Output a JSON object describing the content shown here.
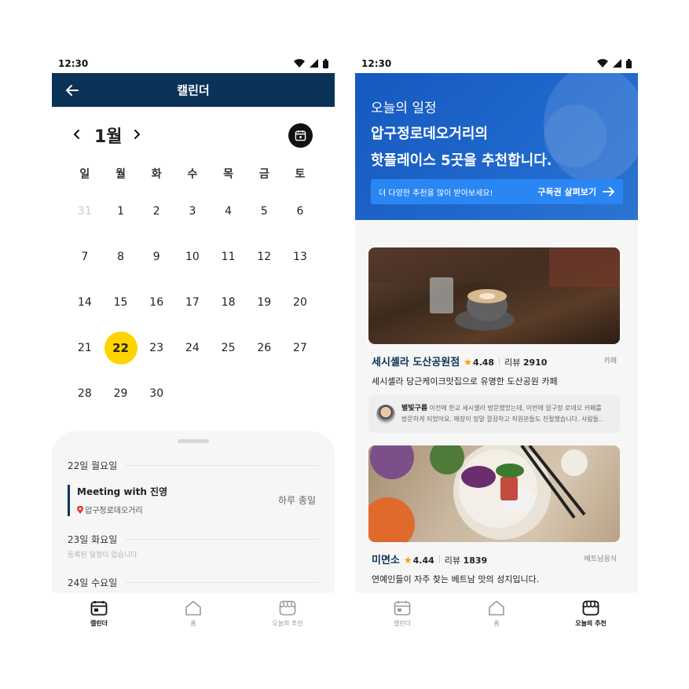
{
  "left": {
    "status": {
      "time": "12:30"
    },
    "appbar": {
      "title": "캘린더"
    },
    "calendar": {
      "month": "1월",
      "weekdays": [
        "일",
        "월",
        "화",
        "수",
        "목",
        "금",
        "토"
      ],
      "days": [
        "31",
        "1",
        "2",
        "3",
        "4",
        "5",
        "6",
        "7",
        "8",
        "9",
        "10",
        "11",
        "12",
        "13",
        "14",
        "15",
        "16",
        "17",
        "18",
        "19",
        "20",
        "21",
        "22",
        "23",
        "24",
        "25",
        "26",
        "27",
        "28",
        "29",
        "30"
      ],
      "selected": "22"
    },
    "schedule": {
      "day1": {
        "label": "22일 월요일"
      },
      "event": {
        "title": "Meeting with 진영",
        "location": "압구정로데오거리",
        "time": "하루 종일"
      },
      "day2": {
        "label": "23일 화요일",
        "empty": "등록된 일정이 없습니다"
      },
      "day3": {
        "label": "24일 수요일"
      }
    },
    "nav": {
      "calendar": "캘린더",
      "home": "홈",
      "today": "오늘의 추천"
    }
  },
  "right": {
    "status": {
      "time": "12:30"
    },
    "banner": {
      "sub": "오늘의 일정",
      "line1": "압구정로데오거리의",
      "line2": "핫플레이스 5곳을 추천합니다.",
      "cta_left": "더 다양한 추천을 많이 받아보세요!",
      "cta_right": "구독권 살펴보기"
    },
    "cards": [
      {
        "name": "세시셸라 도산공원점",
        "rating": "4.48",
        "review_label": "리뷰",
        "review_count": "2910",
        "category": "카페",
        "description": "세시셸라 당근케이크맛집으로 유명한 도산공원 카페",
        "review_user": "별빛구름",
        "review_text1": "이전에 한교 세시셸라 방문했었는데, 이번에 압구정 로데오 카페를",
        "review_text2": "방문하게 되었어요. 매장이 정말 깔끔하고 직원분들도 친절했습니다. 사람들.."
      },
      {
        "name": "미면소",
        "rating": "4.44",
        "review_label": "리뷰",
        "review_count": "1839",
        "category": "베트남음식",
        "description": "연예인들이 자주 찾는 베트남 맛의 성지입니다."
      }
    ],
    "nav": {
      "calendar": "캘린더",
      "home": "홈",
      "today": "오늘의 추천"
    }
  },
  "colors": {
    "navy": "#0b3358",
    "highlight": "#ffd400",
    "banner": "#1559bf",
    "cta": "#2a86f2",
    "star": "#f5a000"
  }
}
